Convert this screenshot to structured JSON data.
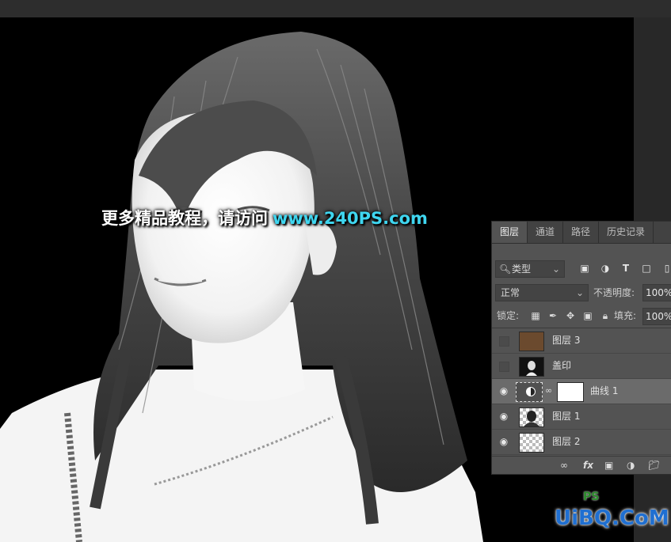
{
  "canvas": {
    "watermark_cn": "更多精品教程，请访问",
    "watermark_url": "www.240PS.com"
  },
  "layers_panel": {
    "tabs": [
      {
        "label": "图层"
      },
      {
        "label": "通道"
      },
      {
        "label": "路径"
      },
      {
        "label": "历史记录"
      }
    ],
    "filter_label": "类型",
    "blend_mode": "正常",
    "opacity_label": "不透明度:",
    "opacity_value": "100%",
    "lock_label": "锁定:",
    "fill_label": "填充:",
    "fill_value": "100%",
    "layers": [
      {
        "name": "图层 3",
        "visible": false,
        "thumbnail": "brown-fill"
      },
      {
        "name": "盖印",
        "visible": false,
        "thumbnail": "portrait-dark"
      },
      {
        "name": "曲线 1",
        "visible": true,
        "thumbnail": "curves-adjustment",
        "selected": true
      },
      {
        "name": "图层 1",
        "visible": true,
        "thumbnail": "portrait-cutout"
      },
      {
        "name": "图层 2",
        "visible": true,
        "thumbnail": "transparent-checker"
      }
    ]
  },
  "site_logo": {
    "text": "UiBQ.CoM",
    "ps_mark": "PS"
  },
  "colors": {
    "panel_bg": "#535353",
    "url_accent": "#3fd6f0",
    "brown_swatch": "#6b4a2e"
  }
}
